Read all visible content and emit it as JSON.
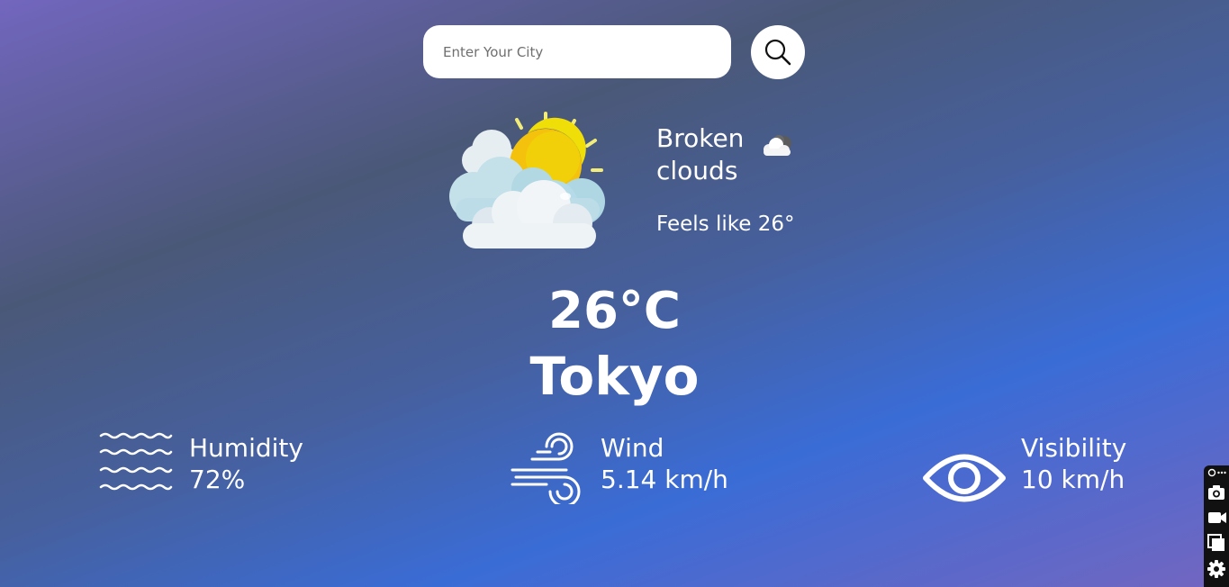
{
  "search": {
    "placeholder": "Enter Your City",
    "button_icon": "search-icon"
  },
  "weather": {
    "description_line1": "Broken",
    "description_line2": "clouds",
    "feels_like": "Feels like 26°",
    "temperature": "26°C",
    "city": "Tokyo",
    "main_icon": "sun-behind-clouds-icon",
    "description_icon": "broken-clouds-icon"
  },
  "stats": {
    "humidity": {
      "label": "Humidity",
      "value": "72%",
      "icon": "humidity-waves-icon"
    },
    "wind": {
      "label": "Wind",
      "value": "5.14 km/h",
      "icon": "wind-icon"
    },
    "visibility": {
      "label": "Visibility",
      "value": "10 km/h",
      "icon": "eye-icon"
    }
  },
  "widget": {
    "icons": [
      "link-icon",
      "more-icon",
      "camera-icon",
      "video-icon",
      "window-icon",
      "settings-icon"
    ]
  },
  "colors": {
    "background_start": "#7266be",
    "background_mid": "#46609e",
    "background_accent": "#3a6cd6",
    "sun_yellow": "#f4c20d",
    "cloud_blue": "#b6dbe8"
  }
}
